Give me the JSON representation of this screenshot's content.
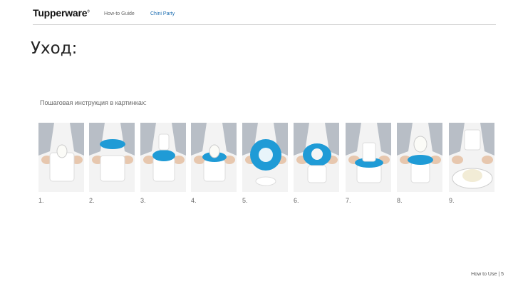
{
  "header": {
    "logo": "Tupperware",
    "nav": [
      {
        "label": "How-to Guide",
        "active": false
      },
      {
        "label": "Chini Party",
        "active": true
      }
    ]
  },
  "title": "Уход:",
  "subtitle": "Пошаговая инструкция в картинках:",
  "steps": [
    {
      "number": "1.",
      "scene": "container-with-egg"
    },
    {
      "number": "2.",
      "scene": "blue-lid-placed"
    },
    {
      "number": "3.",
      "scene": "blue-lid-on-container"
    },
    {
      "number": "4.",
      "scene": "blue-ring-open"
    },
    {
      "number": "5.",
      "scene": "blue-ring-top-view"
    },
    {
      "number": "6.",
      "scene": "blue-ring-closeup"
    },
    {
      "number": "7.",
      "scene": "cup-on-blue-ring"
    },
    {
      "number": "8.",
      "scene": "cup-upright"
    },
    {
      "number": "9.",
      "scene": "serving-on-plate"
    }
  ],
  "footer": {
    "label": "How to Use",
    "separator": "|",
    "page": "5"
  },
  "colors": {
    "accent": "#1f9bd6",
    "container": "#ffffff",
    "skin": "#e7c7ae",
    "shirt": "#b8bec6"
  }
}
